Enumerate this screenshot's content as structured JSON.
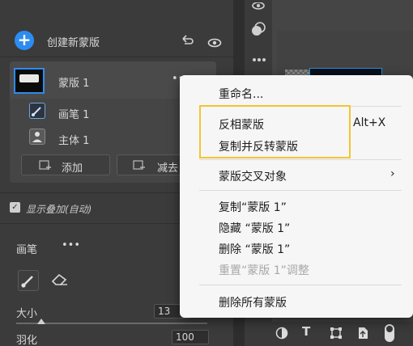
{
  "top_icons": {
    "eye": "eye-icon",
    "cluster": "layers-icon",
    "more": "more-icon"
  },
  "masks_panel": {
    "create_label": "创建新蒙版",
    "mask": {
      "name": "蒙版 1",
      "more": "•••"
    },
    "sub_items": [
      {
        "label": "画笔 1",
        "icon": "brush-icon"
      },
      {
        "label": "主体 1",
        "icon": "person-icon"
      }
    ],
    "add_label": "添加",
    "subtract_label": "减去"
  },
  "overlay": {
    "label": "显示叠加(自动)",
    "checked": true
  },
  "brush": {
    "title": "画笔",
    "more": "•••",
    "size_label": "大小",
    "size_value": "13",
    "feather_label": "羽化",
    "feather_value": "100",
    "size_slider_fraction": 0.13
  },
  "context_menu": {
    "rename": "重命名...",
    "invert": "反相蒙版",
    "invert_shortcut": "Alt+X",
    "duplicate_invert": "复制并反转蒙版",
    "intersect": "蒙版交叉对象",
    "duplicate": "复制“蒙版 1”",
    "hide": "隐藏 “蒙版 1”",
    "delete": "删除 “蒙版 1”",
    "reset": "重置“蒙版 1”调整",
    "delete_all": "删除所有蒙版"
  },
  "colors": {
    "accent": "#2d8cf0",
    "highlight": "#f4c430",
    "menu_bg": "#f6f6f6"
  }
}
